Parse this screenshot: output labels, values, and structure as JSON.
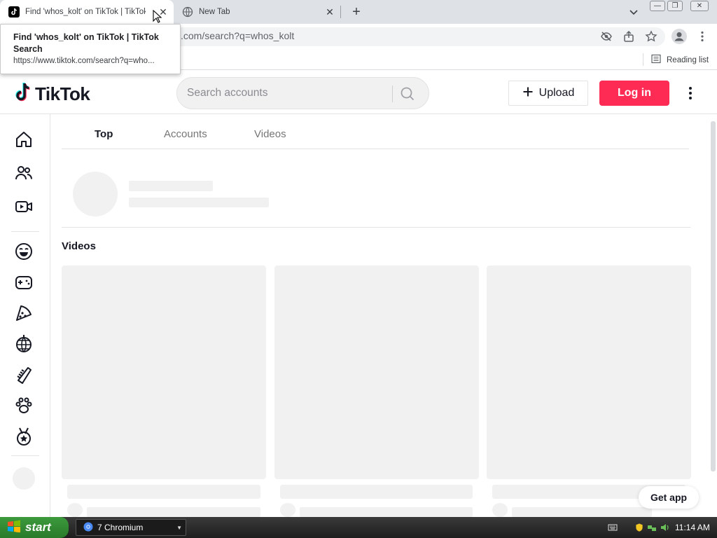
{
  "browser": {
    "tabs": [
      {
        "title": "Find 'whos_kolt' on TikTok | TikTok",
        "active": true
      },
      {
        "title": "New Tab",
        "active": false
      }
    ],
    "url": ".com/search?q=whos_kolt",
    "reading_list_label": "Reading list",
    "tooltip": {
      "title": "Find 'whos_kolt' on TikTok | TikTok Search",
      "url": "https://www.tiktok.com/search?q=who..."
    }
  },
  "tiktok": {
    "logo_text": "TikTok",
    "search_placeholder": "Search accounts",
    "upload_label": "Upload",
    "login_label": "Log in",
    "tabs": [
      "Top",
      "Accounts",
      "Videos"
    ],
    "active_tab": "Top",
    "videos_heading": "Videos",
    "get_app_label": "Get app",
    "brand_color": "#fe2c55",
    "sidebar_icons": [
      "home-icon",
      "following-icon",
      "live-icon",
      "comedy-icon",
      "gaming-icon",
      "food-icon",
      "dance-icon",
      "beauty-icon",
      "animals-icon",
      "sports-icon"
    ]
  },
  "taskbar": {
    "start_label": "start",
    "task_label": "7 Chromium",
    "clock": "11:14 AM"
  }
}
